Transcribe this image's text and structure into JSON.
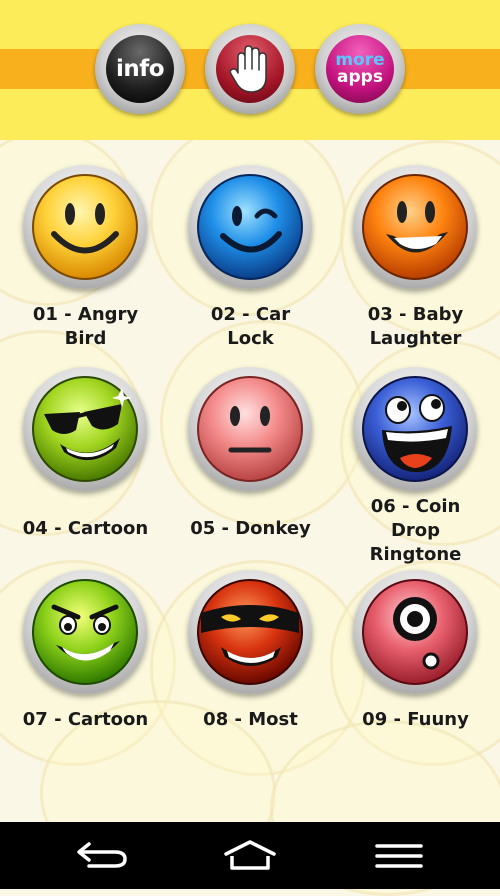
{
  "header": {
    "info_label": "info",
    "more_label_line1": "more",
    "more_label_line2": "apps"
  },
  "sounds": [
    {
      "label_line1": "01 - Angry",
      "label_line2": "Bird",
      "face": "yellow-smile-face-icon"
    },
    {
      "label_line1": "02 - Car",
      "label_line2": "Lock",
      "face": "blue-wink-face-icon"
    },
    {
      "label_line1": "03 - Baby",
      "label_line2": "Laughter",
      "face": "orange-grin-face-icon"
    },
    {
      "label_line1": "04 - Cartoon",
      "label_line2": "",
      "face": "green-sunglasses-face-icon"
    },
    {
      "label_line1": "05 - Donkey",
      "label_line2": "",
      "face": "pink-neutral-face-icon"
    },
    {
      "label_line1": "06 - Coin",
      "label_line2": "Drop",
      "label_line3": "Ringtone",
      "face": "blue-laughing-face-icon"
    },
    {
      "label_line1": "07 - Cartoon",
      "label_line2": "",
      "face": "green-evil-face-icon"
    },
    {
      "label_line1": "08 - Most",
      "label_line2": "",
      "face": "ninja-face-icon"
    },
    {
      "label_line1": "09 - Fuuny",
      "label_line2": "",
      "face": "red-cyclops-face-icon"
    }
  ],
  "colors": {
    "header_yellow": "#fcec5a",
    "header_orange": "#f8b11c",
    "navbar": "#000000"
  },
  "navbar": {
    "back": "back-icon",
    "home": "home-icon",
    "recents": "recent-apps-icon"
  }
}
